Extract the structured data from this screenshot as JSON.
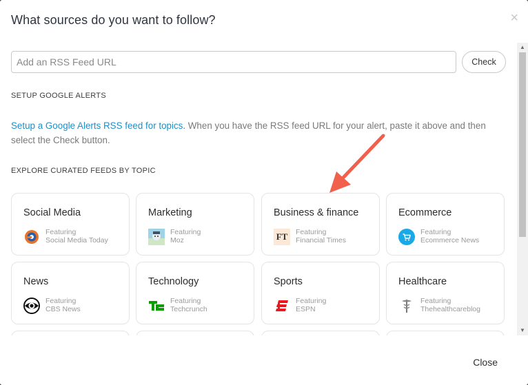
{
  "dialog": {
    "title": "What sources do you want to follow?",
    "close_icon": "×"
  },
  "rss": {
    "placeholder": "Add an RSS Feed URL",
    "value": "",
    "check_label": "Check"
  },
  "google_alerts": {
    "heading": "SETUP GOOGLE ALERTS",
    "link_text": "Setup a Google Alerts RSS feed for topics.",
    "help_text": " When you have the RSS feed URL for your alert, paste it above and then select the Check button."
  },
  "curated": {
    "heading": "EXPLORE CURATED FEEDS BY TOPIC",
    "featuring_label": "Featuring",
    "topics": [
      {
        "title": "Social Media",
        "source": "Social Media Today",
        "icon": "social-media-today-icon"
      },
      {
        "title": "Marketing",
        "source": "Moz",
        "icon": "moz-icon"
      },
      {
        "title": "Business & finance",
        "source": "Financial Times",
        "icon": "financial-times-icon",
        "icon_text": "FT"
      },
      {
        "title": "Ecommerce",
        "source": "Ecommerce News",
        "icon": "shopping-cart-icon"
      },
      {
        "title": "News",
        "source": "CBS News",
        "icon": "cbs-eye-icon"
      },
      {
        "title": "Technology",
        "source": "Techcrunch",
        "icon": "techcrunch-icon"
      },
      {
        "title": "Sports",
        "source": "ESPN",
        "icon": "espn-icon"
      },
      {
        "title": "Healthcare",
        "source": "Thehealthcareblog",
        "icon": "healthcare-blog-icon"
      }
    ]
  },
  "footer": {
    "close_label": "Close"
  },
  "colors": {
    "link": "#1d8fc9",
    "arrow": "#f0604d",
    "card_border": "#e4e4e4"
  }
}
